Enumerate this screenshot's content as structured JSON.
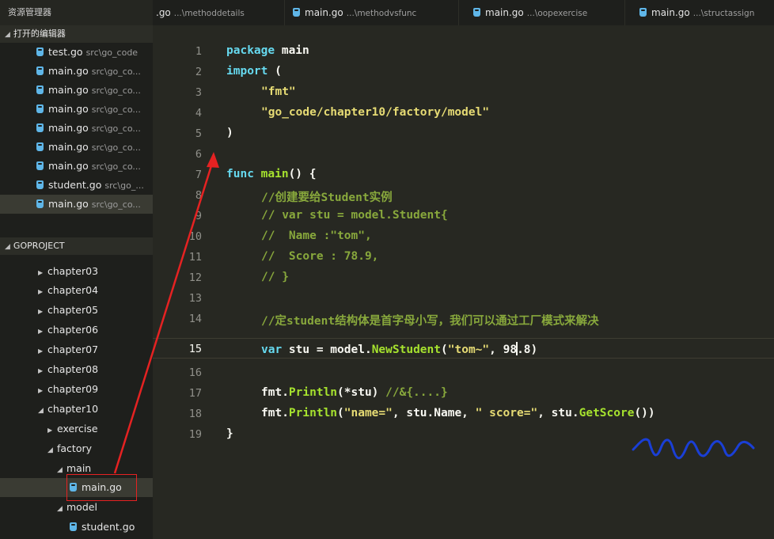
{
  "sidebar": {
    "title": "资源管理器",
    "open_editors_header": "打开的编辑器",
    "open_editors": [
      {
        "name": "test.go",
        "path": "src\\go_code"
      },
      {
        "name": "main.go",
        "path": "src\\go_co..."
      },
      {
        "name": "main.go",
        "path": "src\\go_co..."
      },
      {
        "name": "main.go",
        "path": "src\\go_co..."
      },
      {
        "name": "main.go",
        "path": "src\\go_co..."
      },
      {
        "name": "main.go",
        "path": "src\\go_co..."
      },
      {
        "name": "main.go",
        "path": "src\\go_co..."
      },
      {
        "name": "student.go",
        "path": "src\\go_..."
      },
      {
        "name": "main.go",
        "path": "src\\go_co..."
      }
    ],
    "project_header": "GOPROJECT",
    "chapters": [
      "chapter03",
      "chapter04",
      "chapter05",
      "chapter06",
      "chapter07",
      "chapter08",
      "chapter09",
      "chapter10"
    ],
    "tree": {
      "exercise": "exercise",
      "factory": "factory",
      "main_folder": "main",
      "main_file": "main.go",
      "model_folder": "model",
      "student_file": "student.go"
    }
  },
  "tabs": [
    {
      "name": ".go",
      "path": "...\\methoddetails"
    },
    {
      "name": "main.go",
      "path": "...\\methodvsfunc"
    },
    {
      "name": "main.go",
      "path": "...\\oopexercise"
    },
    {
      "name": "main.go",
      "path": "...\\structassign"
    }
  ],
  "editor": {
    "current_line": 15,
    "line_numbers": [
      "1",
      "2",
      "3",
      "4",
      "5",
      "6",
      "7",
      "8",
      "9",
      "10",
      "11",
      "12",
      "13",
      "14",
      "15",
      "16",
      "17",
      "18",
      "19"
    ],
    "lines": {
      "l1": {
        "kw": "package",
        "rest": " main"
      },
      "l2": {
        "kw": "import",
        "rest": " ("
      },
      "l3": {
        "str": "\"fmt\""
      },
      "l4": {
        "str": "\"go_code/chapter10/factory/model\""
      },
      "l5": {
        "text": ")"
      },
      "l7": {
        "kw": "func",
        "fn": "main",
        "rest": "() {"
      },
      "l8": {
        "comment": "//创建要给Student实例"
      },
      "l9": {
        "comment": "// var stu = model.Student{"
      },
      "l10": {
        "comment": "//  Name :\"tom\","
      },
      "l11": {
        "comment": "//  Score : 78.9,"
      },
      "l12": {
        "comment": "// }"
      },
      "l14": {
        "comment": "//定student结构体是首字母小写，我们可以通过工厂模式来解决"
      },
      "l15": {
        "kw": "var",
        "a": " stu = model.",
        "fn": "NewStudent",
        "b": "(",
        "str": "\"tom~\"",
        "c": ", 98",
        "d": ".8)"
      },
      "l17": {
        "a": "fmt.",
        "fn": "Println",
        "b": "(*stu) ",
        "comment": "//&{....}"
      },
      "l18": {
        "a": "fmt.",
        "fn": "Println",
        "b": "(",
        "str1": "\"name=\"",
        "c": ", stu.Name, ",
        "str2": "\" score=\"",
        "d": ", stu.",
        "fn2": "GetScore",
        "e": "())"
      },
      "l19": {
        "text": "}"
      }
    }
  },
  "colors": {
    "annotation_arrow": "#e52222",
    "annotation_squiggle": "#1a3fd6"
  }
}
